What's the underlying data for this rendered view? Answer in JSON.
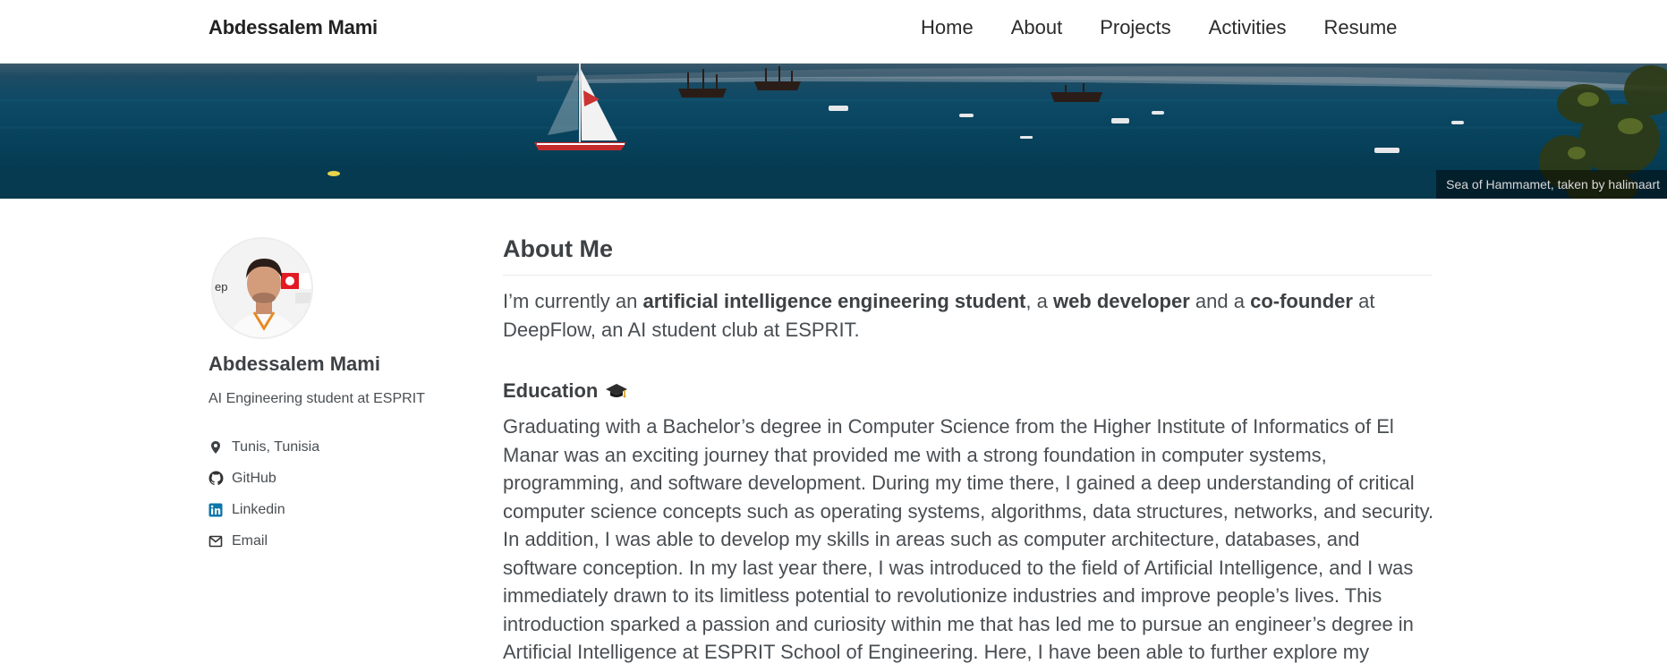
{
  "site": {
    "title": "Abdessalem Mami"
  },
  "nav": {
    "items": [
      "Home",
      "About",
      "Projects",
      "Activities",
      "Resume"
    ]
  },
  "hero": {
    "caption": "Sea of Hammamet, taken by halimaart"
  },
  "sidebar": {
    "name": "Abdessalem Mami",
    "bio": "AI Engineering student at ESPRIT",
    "links": [
      {
        "label": "Tunis, Tunisia",
        "icon": "location-icon"
      },
      {
        "label": "GitHub",
        "icon": "github-icon"
      },
      {
        "label": "Linkedin",
        "icon": "linkedin-icon",
        "color": "#0e76a8"
      },
      {
        "label": "Email",
        "icon": "email-icon"
      }
    ]
  },
  "main": {
    "title": "About Me",
    "intro": {
      "p1": "I’m currently an ",
      "b1": "artificial intelligence engineering student",
      "p2": ", a ",
      "b2": "web developer",
      "p3": " and a ",
      "b3": "co-founder",
      "p4": " at DeepFlow, an AI student club at ESPRIT."
    },
    "education": {
      "heading": "Education",
      "icon": "graduation-cap-icon",
      "text": "Graduating with a Bachelor’s degree in Computer Science from the Higher Institute of Informatics of El Manar was an exciting journey that provided me with a strong foundation in computer systems, programming, and software development. During my time there, I gained a deep understanding of critical computer science concepts such as operating systems, algorithms, data structures, networks, and security. In addition, I was able to develop my skills in areas such as computer architecture, databases, and software conception. In my last year there, I was introduced to the field of Artificial Intelligence, and I was immediately drawn to its limitless potential to revolutionize industries and improve people’s lives. This introduction sparked a passion and curiosity within me that has led me to pursue an engineer’s degree in Artificial Intelligence at ESPRIT School of Engineering. Here, I have been able to further explore my passion"
    }
  }
}
